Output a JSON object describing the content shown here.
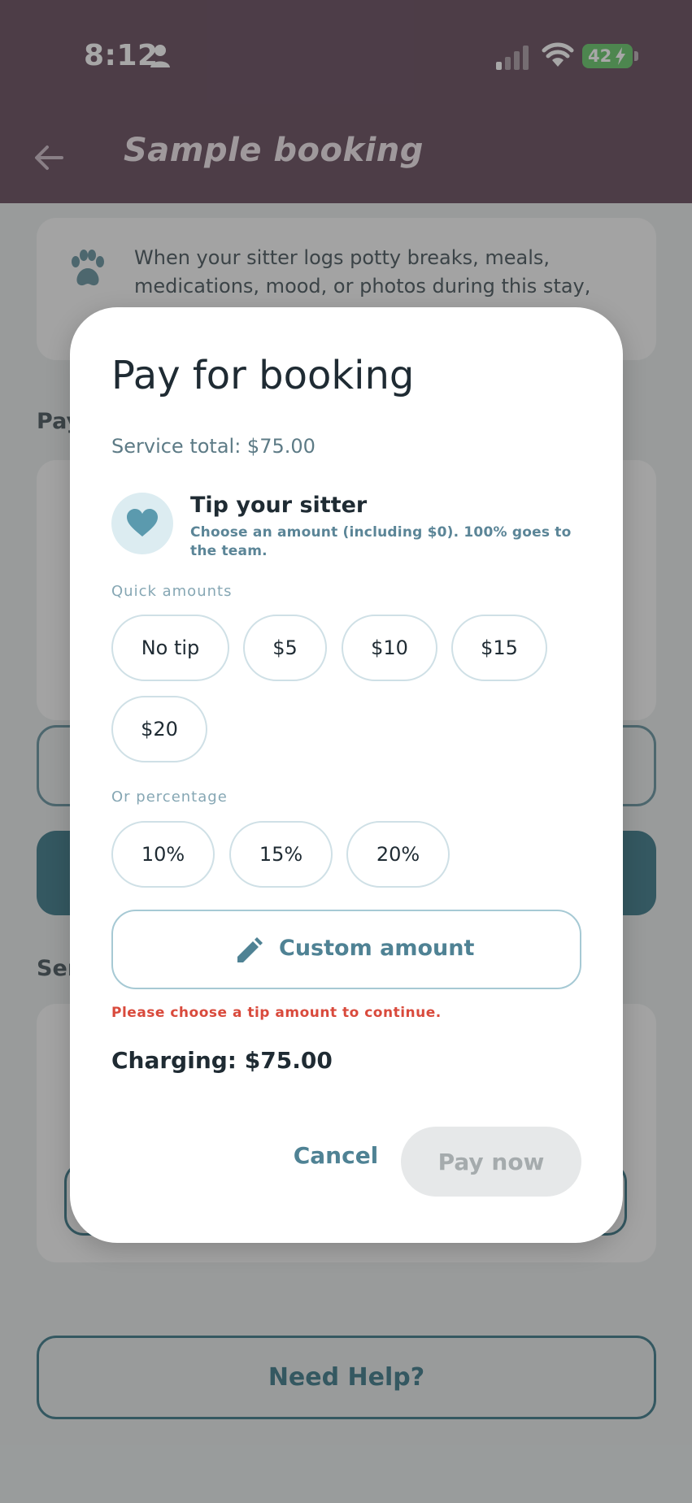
{
  "status_bar": {
    "time": "8:12",
    "battery": "42",
    "icons": [
      "person-icon",
      "cellular-signal-icon",
      "wifi-icon",
      "battery-charging-icon"
    ]
  },
  "app_bar": {
    "title": "Sample booking",
    "back_icon": "back-arrow-icon"
  },
  "background": {
    "info_text": "When your sitter logs potty breaks, meals, medications, mood, or photos during this stay, you",
    "payment_heading": "Pay",
    "services_heading": "Ser",
    "help_button": "Need Help?"
  },
  "dialog": {
    "title": "Pay for booking",
    "service_total": "Service total: $75.00",
    "tip": {
      "title": "Tip your sitter",
      "subtitle": "Choose an amount (including $0). 100% goes to the team.",
      "icon": "heart-icon"
    },
    "quick_label": "Quick amounts",
    "quick_amounts": [
      "No tip",
      "$5",
      "$10",
      "$15",
      "$20"
    ],
    "percent_label": "Or percentage",
    "percentages": [
      "10%",
      "15%",
      "20%"
    ],
    "custom_label": "Custom amount",
    "error": "Please choose a tip amount to continue.",
    "charging": "Charging: $75.00",
    "cancel_label": "Cancel",
    "pay_label": "Pay now",
    "pay_enabled": false
  },
  "colors": {
    "header": "#5b3e51",
    "accent": "#4f8294",
    "error": "#d94a3c"
  }
}
